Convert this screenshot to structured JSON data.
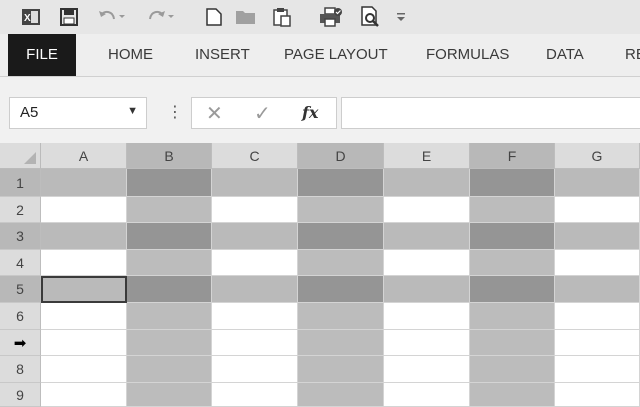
{
  "colors": {
    "col_header_plain": "#dcdcdc",
    "col_header_dark": "#b8b8b8",
    "row_header_plain": "#dcdcdc",
    "row_header_dark": "#b8b8b8",
    "cell_plain": "#ffffff",
    "cell_band_col": "#bcbcbc",
    "cell_band_row": "#bababa",
    "cell_band_both": "#959595"
  },
  "quick_access": {
    "icons": [
      "excel-icon",
      "save-icon",
      "undo-icon",
      "redo-icon",
      "new-file-icon",
      "open-folder-icon",
      "paste-icon",
      "print-icon",
      "print-preview-icon",
      "customize-toolbar-icon"
    ]
  },
  "ribbon": {
    "tabs": [
      {
        "name": "tab-file",
        "label": "FILE"
      },
      {
        "name": "tab-home",
        "label": "HOME"
      },
      {
        "name": "tab-insert",
        "label": "INSERT"
      },
      {
        "name": "tab-page-layout",
        "label": "PAGE LAYOUT"
      },
      {
        "name": "tab-formulas",
        "label": "FORMULAS"
      },
      {
        "name": "tab-data",
        "label": "DATA"
      },
      {
        "name": "tab-review",
        "label": "RE"
      }
    ]
  },
  "formula_bar": {
    "name_box": "A5",
    "dots": "⋮",
    "cancel": "✕",
    "enter": "✓",
    "fx": "fx",
    "value": ""
  },
  "sheet": {
    "columns": [
      "A",
      "B",
      "C",
      "D",
      "E",
      "F",
      "G"
    ],
    "rows": [
      "1",
      "2",
      "3",
      "4",
      "5",
      "6",
      "",
      "8",
      "9"
    ],
    "row_pointer_icon": "➡",
    "banded_columns": [
      "B",
      "D",
      "F"
    ],
    "banded_rows": [
      "1",
      "3",
      "5"
    ],
    "active_cell": "A5"
  }
}
